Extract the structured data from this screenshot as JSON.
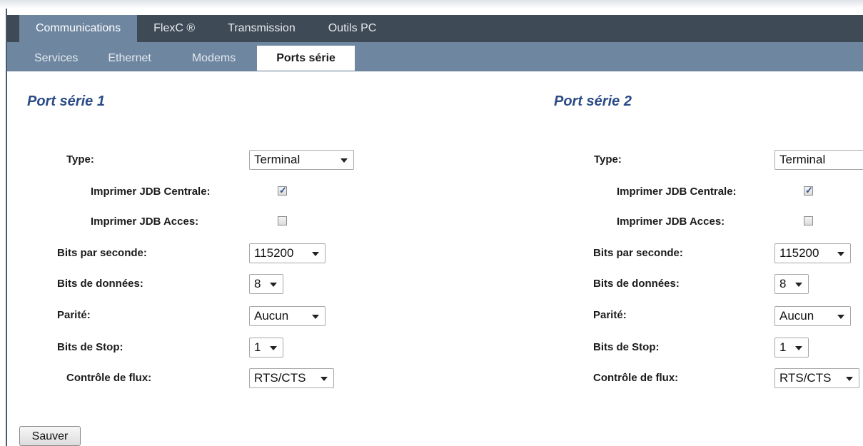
{
  "main_tabs": [
    {
      "label": "Communications",
      "active": true
    },
    {
      "label": "FlexC ®",
      "active": false
    },
    {
      "label": "Transmission",
      "active": false
    },
    {
      "label": "Outils PC",
      "active": false
    }
  ],
  "sub_tabs": [
    {
      "label": "Services",
      "active": false
    },
    {
      "label": "Ethernet",
      "active": false
    },
    {
      "label": "Modems",
      "active": false
    },
    {
      "label": "Ports série",
      "active": true
    }
  ],
  "ports": [
    {
      "title": "Port série 1",
      "type_label": "Type:",
      "type_value": "Terminal",
      "print_central_label": "Imprimer JDB Centrale:",
      "print_central_checked": true,
      "print_access_label": "Imprimer JDB Acces:",
      "print_access_checked": false,
      "baud_label": "Bits par seconde:",
      "baud_value": "115200",
      "data_bits_label": "Bits de données:",
      "data_bits_value": "8",
      "parity_label": "Parité:",
      "parity_value": "Aucun",
      "stop_bits_label": "Bits de Stop:",
      "stop_bits_value": "1",
      "flow_label": "Contrôle de flux:",
      "flow_value": "RTS/CTS"
    },
    {
      "title": "Port série 2",
      "type_label": "Type:",
      "type_value": "Terminal",
      "print_central_label": "Imprimer JDB Centrale:",
      "print_central_checked": true,
      "print_access_label": "Imprimer JDB Acces:",
      "print_access_checked": false,
      "baud_label": "Bits par seconde:",
      "baud_value": "115200",
      "data_bits_label": "Bits de données:",
      "data_bits_value": "8",
      "parity_label": "Parité:",
      "parity_value": "Aucun",
      "stop_bits_label": "Bits de Stop:",
      "stop_bits_value": "1",
      "flow_label": "Contrôle de flux:",
      "flow_value": "RTS/CTS"
    }
  ],
  "save_label": "Sauver",
  "colors": {
    "nav_dark": "#3e4a56",
    "nav_light": "#6e86a0",
    "heading": "#2a4b86"
  }
}
